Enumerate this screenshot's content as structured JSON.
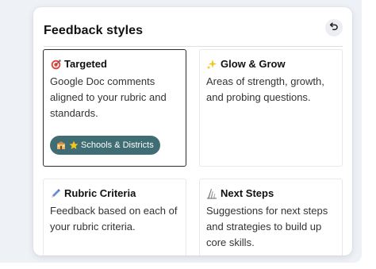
{
  "panel": {
    "title": "Feedback styles",
    "reset_icon": "undo-icon"
  },
  "cards": [
    {
      "title": "Targeted",
      "icon": "target-icon",
      "description": "Google Doc comments aligned to your rubric and standards.",
      "selected": true,
      "badge": {
        "label": "Schools & Districts",
        "icons": [
          "school-icon",
          "star-icon"
        ]
      }
    },
    {
      "title": "Glow & Grow",
      "icon": "sparkles-icon",
      "description": "Areas of strength, growth, and probing questions.",
      "selected": false
    },
    {
      "title": "Rubric Criteria",
      "icon": "pencil-icon",
      "description": "Feedback based on each of your rubric criteria.",
      "selected": false
    },
    {
      "title": "Next Steps",
      "icon": "steps-icon",
      "description": "Suggestions for next steps and strategies to build up core skills.",
      "selected": false
    }
  ],
  "colors": {
    "badge_bg": "#3f6d73",
    "selected_border": "#2b2b2b",
    "target_red": "#e0453a",
    "sparkle_yellow": "#f5c518",
    "pencil_blue": "#6b8fd6"
  }
}
